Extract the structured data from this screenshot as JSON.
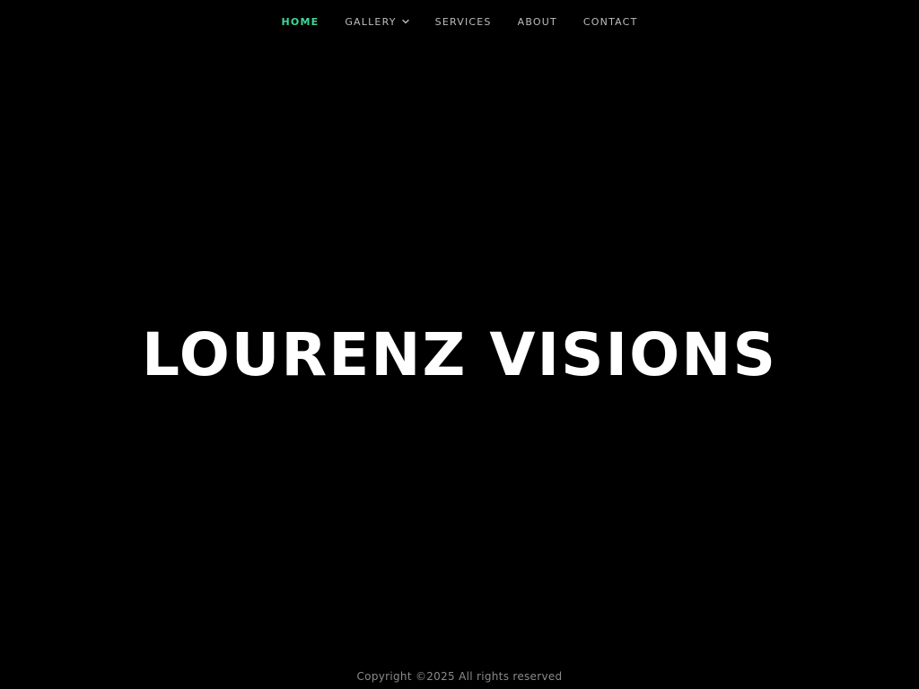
{
  "nav": {
    "items": [
      {
        "label": "HOME",
        "active": true
      },
      {
        "label": "GALLERY",
        "has_dropdown": true
      },
      {
        "label": "SERVICES"
      },
      {
        "label": "ABOUT"
      },
      {
        "label": "CONTACT"
      }
    ],
    "dropdown_icon": "chevron-down-icon"
  },
  "hero": {
    "title": "LOURENZ VISIONS"
  },
  "footer": {
    "copyright": "Copyright ©2025 All rights reserved"
  },
  "colors": {
    "background": "#000000",
    "accent": "#3fd69a",
    "nav_text": "#bdbdbd",
    "title": "#ffffff",
    "footer_text": "#8a8a8a"
  }
}
